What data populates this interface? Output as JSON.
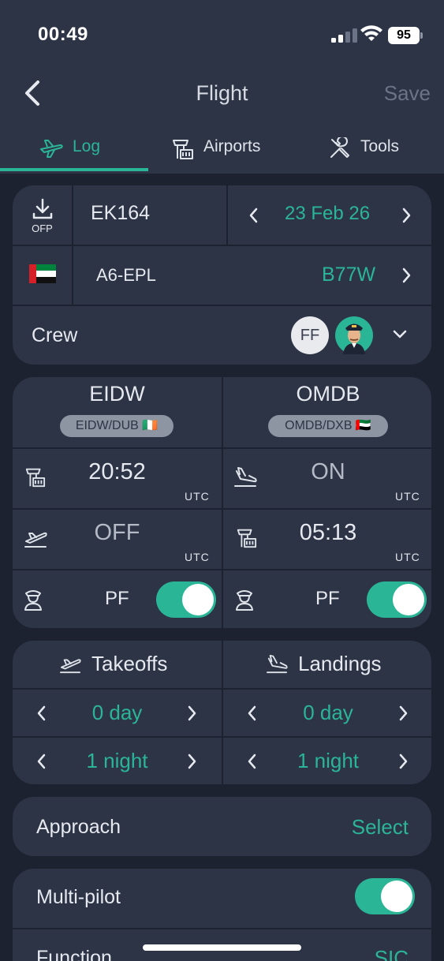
{
  "status_bar": {
    "time": "00:49",
    "battery": "95"
  },
  "nav": {
    "title": "Flight",
    "save_label": "Save"
  },
  "tabs": [
    {
      "label": "Log",
      "active": true
    },
    {
      "label": "Airports",
      "active": false
    },
    {
      "label": "Tools",
      "active": false
    }
  ],
  "flight": {
    "ofp_label": "OFP",
    "flight_number": "EK164",
    "date": "23 Feb 26",
    "registration": "A6-EPL",
    "aircraft_type": "B77W",
    "crew_label": "Crew",
    "crew_initials": "FF"
  },
  "departure": {
    "code": "EIDW",
    "pill": "EIDW/DUB 🇮🇪",
    "out_time": "20:52",
    "off_time": "OFF",
    "tz": "UTC",
    "pf_label": "PF",
    "pf_on": true
  },
  "arrival": {
    "code": "OMDB",
    "pill": "OMDB/DXB 🇦🇪",
    "on_time": "ON",
    "in_time": "05:13",
    "tz": "UTC",
    "pf_label": "PF",
    "pf_on": true
  },
  "counts": {
    "takeoffs_label": "Takeoffs",
    "landings_label": "Landings",
    "takeoffs_day": "0 day",
    "takeoffs_night": "1 night",
    "landings_day": "0 day",
    "landings_night": "1 night"
  },
  "approach": {
    "label": "Approach",
    "value": "Select"
  },
  "multipilot": {
    "label": "Multi-pilot",
    "on": true
  },
  "function": {
    "label": "Function",
    "value": "SIC"
  },
  "colors": {
    "accent": "#2bb597",
    "panel": "#2d3446",
    "background": "#1c2230"
  }
}
